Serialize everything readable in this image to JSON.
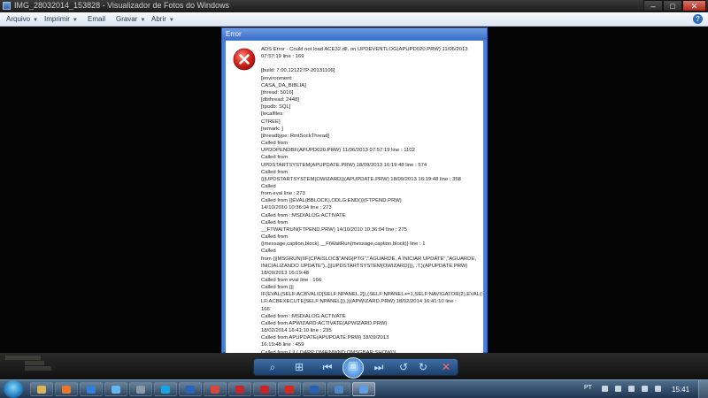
{
  "window": {
    "title": "IMG_28032014_153828 - Visualizador de Fotos do Windows",
    "min_glyph": "–",
    "max_glyph": "□",
    "close_glyph": "✕"
  },
  "menu": [
    {
      "label": "Arquivo",
      "has_dropdown": true
    },
    {
      "label": "Imprimir",
      "has_dropdown": true
    },
    {
      "label": "Email",
      "has_dropdown": false
    },
    {
      "label": "Gravar",
      "has_dropdown": true
    },
    {
      "label": "Abrir",
      "has_dropdown": true
    }
  ],
  "dialog": {
    "title": "Error",
    "icon": "error-icon",
    "lines": [
      "ADS Error - Could not load ACE32.dll. on UPDEVENTLOG(APUPD020.PRW) 11/06/2013",
      "07:57:19 line : 169",
      "",
      "[build: 7.00.121227P-20131106]",
      "[environment:",
      "CASA_DA_BIBLIA]",
      "[thread: 5016]",
      "[dbthread: 2448]",
      "[rpodb: SQL]",
      "[localfiles:",
      "CTREE]",
      "[remark: ]",
      "[threadtype: RmtSockThread]",
      "Called from",
      "UPDOPENDBF(APUPD020.PRW) 11/06/2013 07:57:19 line : 1102",
      "Called from",
      "UPDSTARTSYSTEM(APUPDATE.PRW) 18/09/2013 16:19:48 line : 574",
      "Called from",
      "{||UPDSTARTSYSTEM(OWIZARD)}(APUPDATE.PRW) 18/09/2013 16:19:48 line : 358",
      "Called",
      "from eval line : 273",
      "Called from {|EVAL(BBLOCK),ODLG:END()}(FTPEND.PRW)",
      "14/10/2010 10:36:04 line : 273",
      "Called from ::MSDIALOG:ACTIVATE",
      "Called from",
      "__FTWAITRUN(FTPEND.PRW) 14/10/2010 10:36:04 line : 275",
      "Called from",
      "{|message,caption,block| __FtWaitRun(message,caption,block)} line : 1",
      "Called",
      "from {||MSGRUN(IIF(CPAISLOC$\"ANG|PTG\",\"AGUARDE, A INICIAR UPDATE\",\"AGUARDE,",
      "INICIALIZANDO UPDATE\"),,{||UPDSTARTSYSTEM(OWIZARD)}), .T.}(APUPDATE.PRW)",
      "18/09/2013 16:19:48",
      "Called from eval line : 166",
      "Called from {||",
      "IF(EVAL(SELF:ACBVALID[SELF:NPANEL,2]),(SELF:NPANEL+=1,SELF:NAVIGATOR(2),EVAL(SE",
      "LF:ACBEXECUTE[SELF:NPANEL])),)}(APWIZARD.PRW) 18/02/2014 16:41:10 line :",
      "166",
      "Called from ::MSDIALOG:ACTIVATE",
      "Called from APWIZARD:ACTIVATE(APWIZARD.PRW)",
      "18/02/2014 16:41:10 line : 235",
      "Called from APUPDATE(APUPDATE.PRW) 18/09/2013",
      "16:19:48 line : 459",
      "Called from { || ( OAPP:OMAINWND:OMSGBAR:SHOW()),"
    ]
  },
  "controls": [
    {
      "name": "zoom-icon",
      "glyph": "⌕"
    },
    {
      "name": "actual-size-icon",
      "glyph": "⊞"
    },
    {
      "name": "previous-icon",
      "glyph": "⏮"
    },
    {
      "name": "slideshow-icon",
      "glyph": "▣"
    },
    {
      "name": "next-icon",
      "glyph": "⏭"
    },
    {
      "name": "rotate-left-icon",
      "glyph": "↺"
    },
    {
      "name": "rotate-right-icon",
      "glyph": "↻"
    },
    {
      "name": "delete-icon",
      "glyph": "✕"
    }
  ],
  "taskbar": {
    "items": [
      {
        "name": "explorer-icon",
        "color": "#d9b45a"
      },
      {
        "name": "firefox-icon",
        "color": "#e8772e"
      },
      {
        "name": "app-blue-icon",
        "color": "#2f7fd6"
      },
      {
        "name": "app-lightblue-icon",
        "color": "#63b6ef"
      },
      {
        "name": "app-gray-icon",
        "color": "#8a9aa8"
      },
      {
        "name": "skype-icon",
        "color": "#19a3e0"
      },
      {
        "name": "outlook-icon",
        "color": "#2a63b8"
      },
      {
        "name": "chrome-icon",
        "color": "#d9463b"
      },
      {
        "name": "app-red-icon",
        "color": "#c0282d"
      },
      {
        "name": "app-redtri-icon",
        "color": "#c4262e"
      },
      {
        "name": "pdf-icon",
        "color": "#d22a22"
      },
      {
        "name": "word-icon",
        "color": "#2d5fb0"
      },
      {
        "name": "app-person-icon",
        "color": "#4f86c6"
      },
      {
        "name": "photo-viewer-icon",
        "color": "#5f9ede"
      }
    ],
    "active_index": 13,
    "language": "PT",
    "clock": "15:41"
  }
}
